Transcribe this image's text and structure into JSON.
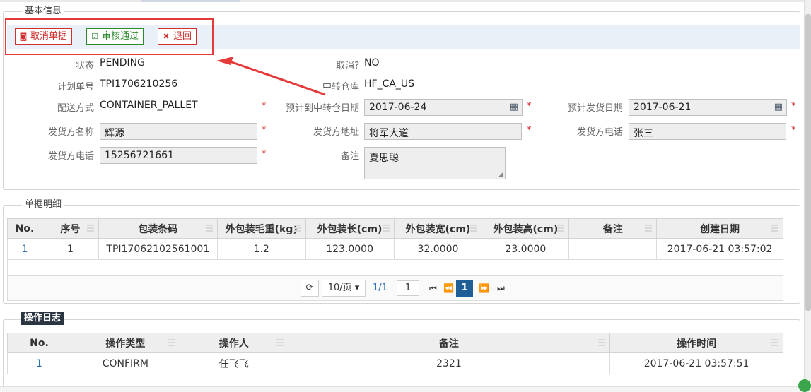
{
  "basic_info": {
    "legend": "基本信息",
    "toolbar": {
      "cancel_label": "取消单据",
      "approve_label": "审核通过",
      "return_label": "退回"
    },
    "fields": {
      "status_label": "状态",
      "status_value": "PENDING",
      "cancelled_label": "取消?",
      "cancelled_value": "NO",
      "plan_no_label": "计划单号",
      "plan_no_value": "TPI1706210256",
      "transit_wh_label": "中转仓库",
      "transit_wh_value": "HF_CA_US",
      "delivery_method_label": "配送方式",
      "delivery_method_value": "CONTAINER_PALLET",
      "eta_transit_label": "预计到中转仓日期",
      "eta_transit_value": "2017-06-24",
      "ship_date_label": "预计发货日期",
      "ship_date_value": "2017-06-21",
      "shipper_name_label": "发货方名称",
      "shipper_name_value": "辉源",
      "shipper_address_label": "发货方地址",
      "shipper_address_value": "将军大道",
      "shipper_phone_label": "发货方电话",
      "shipper_phone_value": "张三",
      "shipper_phone2_label": "发货方电话",
      "shipper_phone2_value": "15256721661",
      "remark_label": "备注",
      "remark_value": "夏思聪",
      "required_mark": "*"
    }
  },
  "details": {
    "legend": "单据明细",
    "columns": [
      "No.",
      "序号",
      "包装条码",
      "外包装毛重(kg)",
      "外包装长(cm)",
      "外包装宽(cm)",
      "外包装高(cm)",
      "备注",
      "创建日期"
    ],
    "rows": [
      [
        "1",
        "1",
        "TPI17062102561001",
        "1.2",
        "123.0000",
        "32.0000",
        "23.0000",
        "",
        "2017-06-21 03:57:02"
      ]
    ],
    "pager": {
      "page_size": "10/页",
      "page_info": "1/1",
      "page_input": "1",
      "current_page": "1"
    }
  },
  "log": {
    "legend": "操作日志",
    "columns": [
      "No.",
      "操作类型",
      "操作人",
      "备注",
      "操作时间"
    ],
    "rows": [
      [
        "1",
        "CONFIRM",
        "任飞飞",
        "2321",
        "2017-06-21 03:57:51"
      ]
    ]
  },
  "icons": {
    "cancel": "stop-circle-icon",
    "approve": "check-square-icon",
    "return": "x-icon",
    "calendar": "calendar-icon",
    "refresh": "refresh-icon"
  },
  "colors": {
    "danger": "#d03030",
    "success": "#2e8a2e",
    "highlight": "#e53a3a",
    "pager_active": "#1f5f96",
    "toolbar_bg": "#e9f0f7"
  }
}
